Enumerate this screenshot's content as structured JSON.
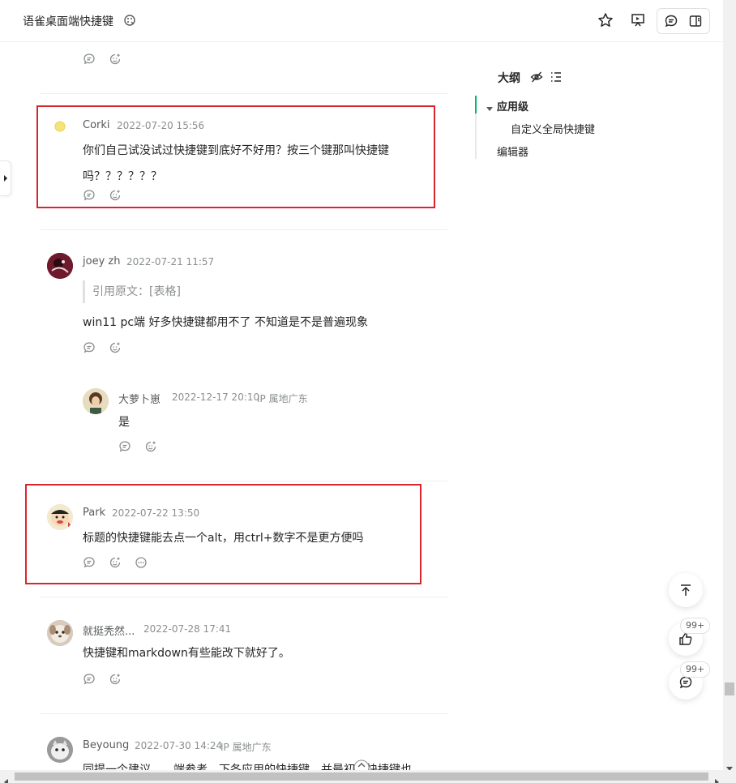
{
  "header": {
    "title": "语雀桌面端快捷键",
    "icons": [
      "star-icon",
      "present-icon",
      "comment-icon",
      "panel-icon"
    ]
  },
  "outline": {
    "title": "大纲",
    "items": [
      {
        "label": "应用级",
        "level": 1,
        "active": true
      },
      {
        "label": "自定义全局快捷键",
        "level": 2
      },
      {
        "label": "编辑器",
        "level": 1
      }
    ]
  },
  "comments": [
    {
      "author": "Corki",
      "date": "2022-07-20 15:56",
      "content": "你们自己试没试过快捷键到底好不好用？按三个键那叫快捷键吗？？？？？？"
    },
    {
      "author": "joey zh",
      "date": "2022-07-21 11:57",
      "quote": "引用原文：[表格]",
      "content": "win11 pc端 好多快捷键都用不了 不知道是不是普遍现象"
    },
    {
      "author": "大萝卜崽",
      "date": "2022-12-17 20:10",
      "ip": "IP 属地广东",
      "content": "是"
    },
    {
      "author": "Park",
      "date": "2022-07-22 13:50",
      "content": "标题的快捷键能去点一个alt，用ctrl+数字不是更方便吗"
    },
    {
      "author": "就挺秃然...",
      "date": "2022-07-28 17:41",
      "content": "快捷键和markdown有些能改下就好了。"
    },
    {
      "author": "Beyoung",
      "date": "2022-07-30 14:24",
      "ip": "IP 属地广东",
      "content": "同提一个建议……端参考，下各应用的快捷键，并最初的快捷键也"
    }
  ],
  "floating": {
    "like_count": "99+",
    "comment_count": "99+"
  },
  "colors": {
    "accent": "#00b96b",
    "highlight_box": "#d9262e"
  }
}
